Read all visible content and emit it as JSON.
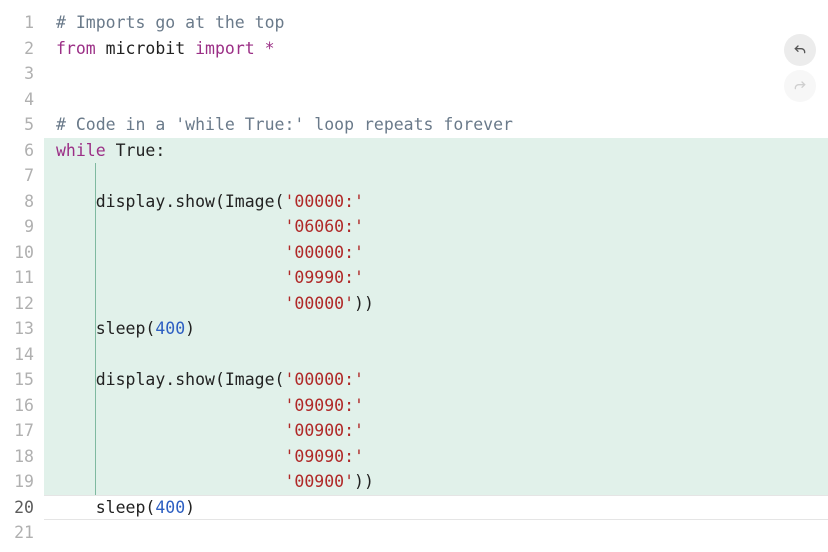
{
  "toolbar": {
    "undo_name": "undo-button",
    "redo_name": "redo-button"
  },
  "line_count": 21,
  "current_line": 20,
  "highlighted_lines": [
    6,
    7,
    8,
    9,
    10,
    11,
    12,
    13,
    14,
    15,
    16,
    17,
    18,
    19
  ],
  "code": {
    "l1": {
      "c": "# Imports go at the top"
    },
    "l2": {
      "kw1": "from",
      "id": " microbit ",
      "kw2": "import",
      "op": " *"
    },
    "l3": {
      "t": ""
    },
    "l4": {
      "t": ""
    },
    "l5": {
      "c": "# Code in a 'while True:' loop repeats forever"
    },
    "l6": {
      "kw": "while",
      "id": " True",
      "p": ":"
    },
    "l7": {
      "t": ""
    },
    "l8": {
      "pre": "    display.show(Image(",
      "s": "'00000:'"
    },
    "l9": {
      "pre": "                       ",
      "s": "'06060:'"
    },
    "l10": {
      "pre": "                       ",
      "s": "'00000:'"
    },
    "l11": {
      "pre": "                       ",
      "s": "'09990:'"
    },
    "l12": {
      "pre": "                       ",
      "s": "'00000'",
      "p": "))"
    },
    "l13": {
      "pre": "    sleep(",
      "n": "400",
      "p": ")"
    },
    "l14": {
      "t": ""
    },
    "l15": {
      "pre": "    display.show(Image(",
      "s": "'00000:'"
    },
    "l16": {
      "pre": "                       ",
      "s": "'09090:'"
    },
    "l17": {
      "pre": "                       ",
      "s": "'00900:'"
    },
    "l18": {
      "pre": "                       ",
      "s": "'09090:'"
    },
    "l19": {
      "pre": "                       ",
      "s": "'00900'",
      "p": "))"
    },
    "l20": {
      "pre": "    sleep(",
      "n": "400",
      "p": ")"
    },
    "l21": {
      "t": ""
    }
  }
}
